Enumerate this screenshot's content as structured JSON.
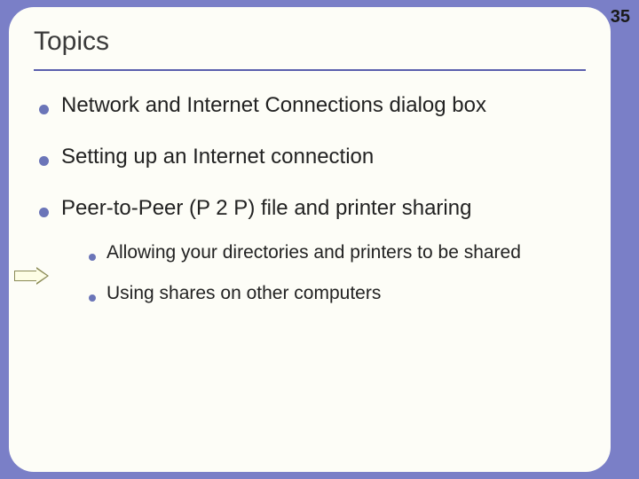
{
  "slide": {
    "title": "Topics",
    "page_number": "35",
    "bullets": [
      {
        "text": "Network and Internet Connections dialog box"
      },
      {
        "text": "Setting up an Internet connection"
      },
      {
        "text": "Peer-to-Peer (P 2 P) file and printer sharing",
        "sub": [
          {
            "text": "Allowing your directories and printers to be shared"
          },
          {
            "text": "Using shares on other computers"
          }
        ]
      }
    ]
  }
}
